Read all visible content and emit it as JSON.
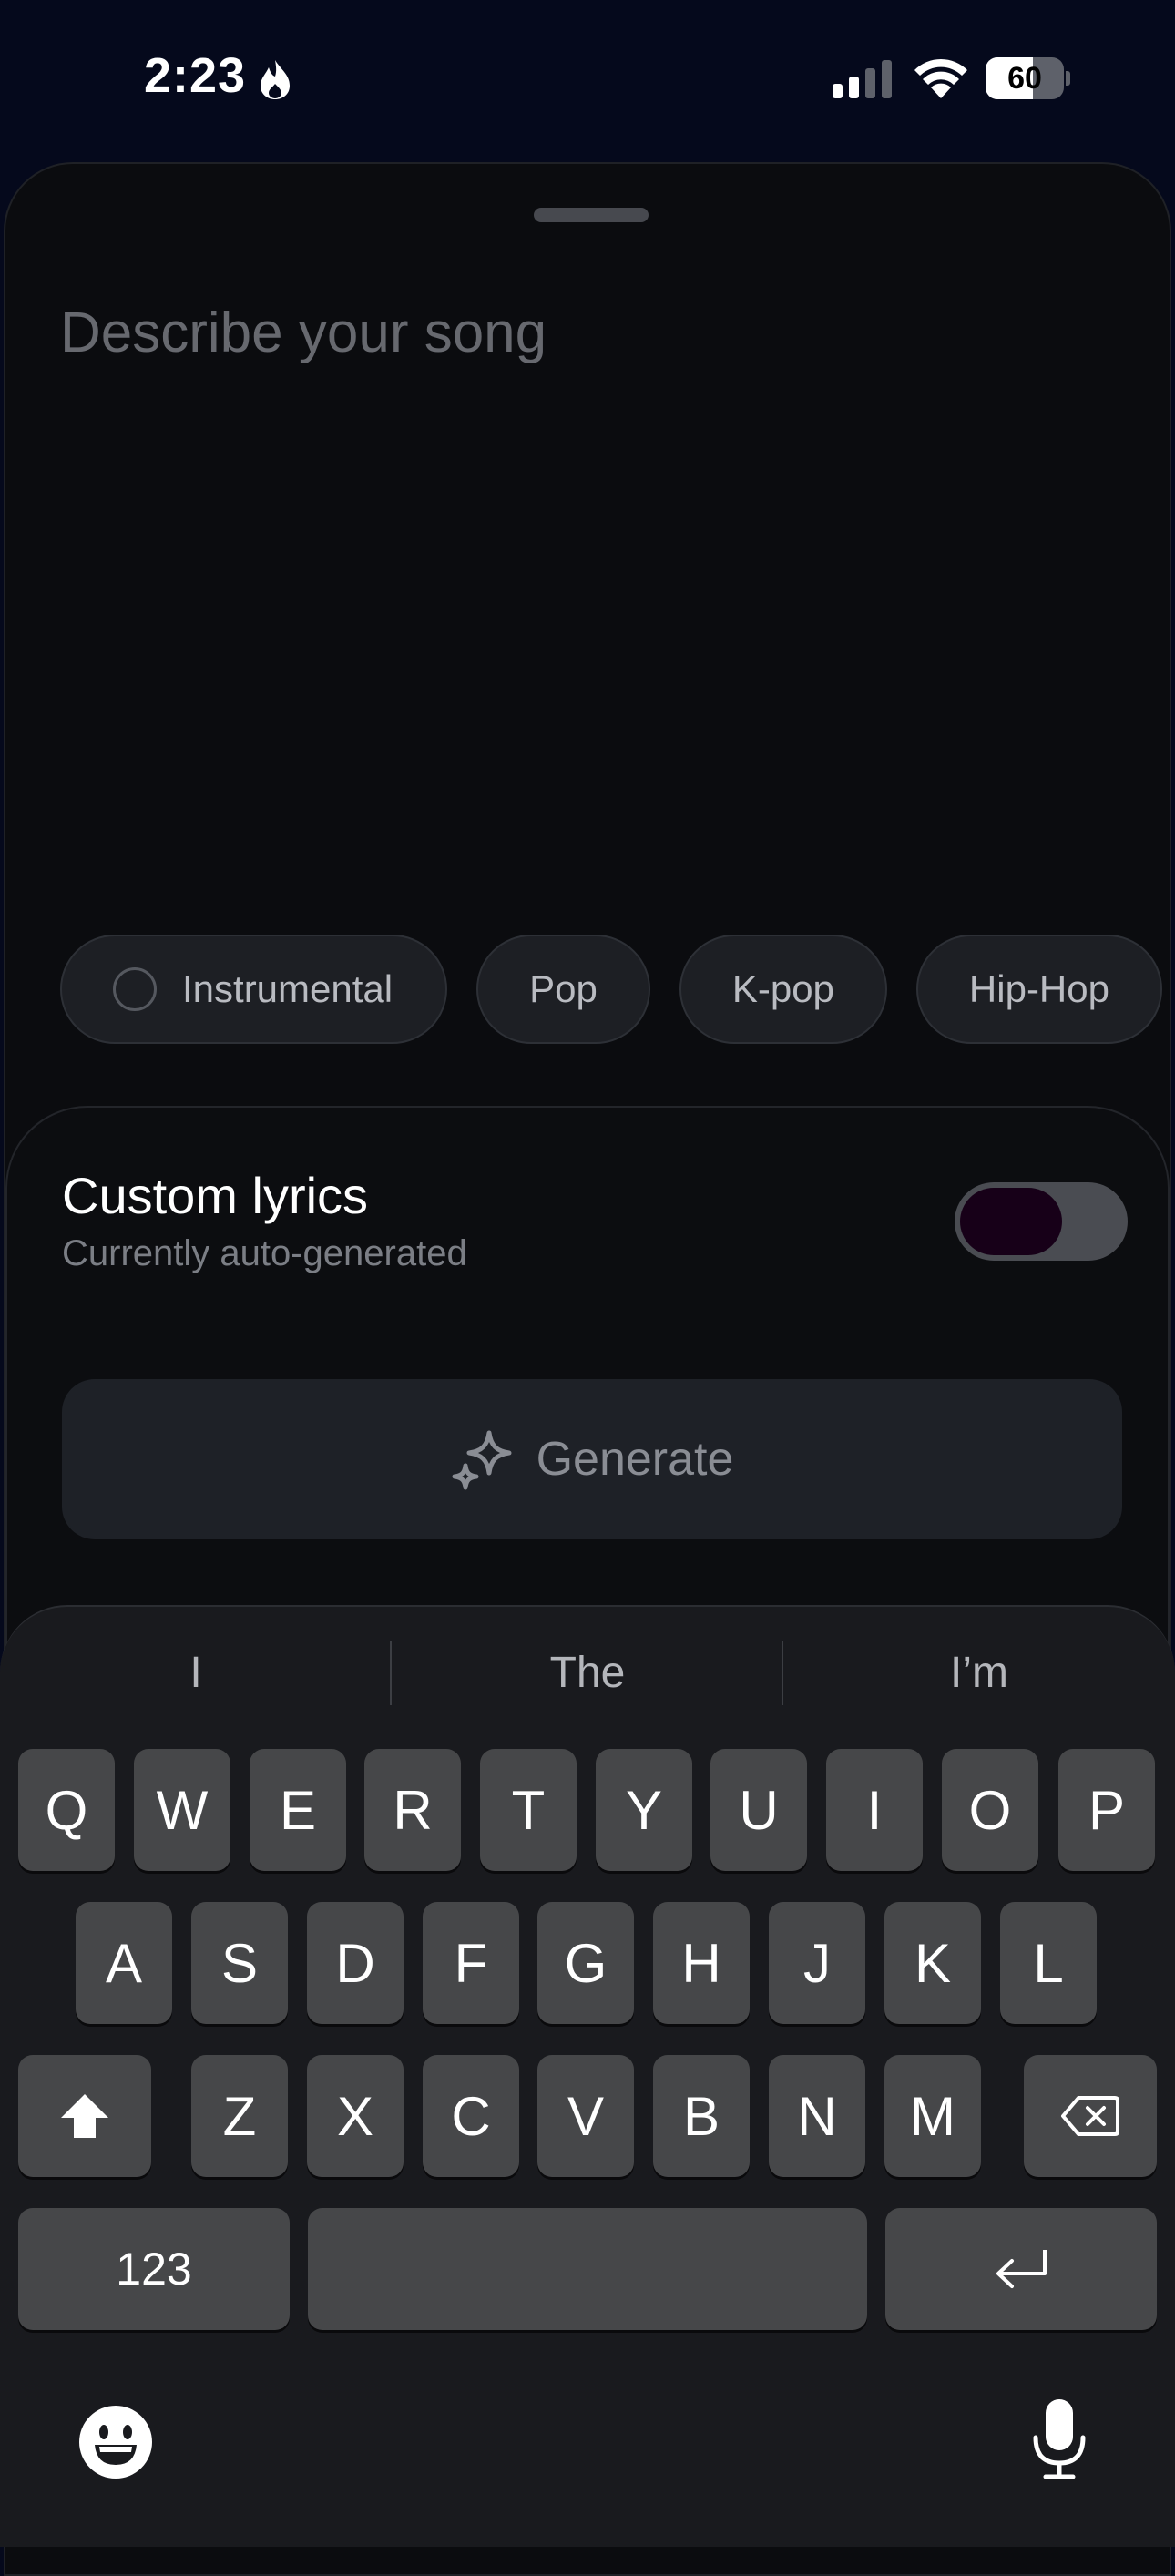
{
  "status_bar": {
    "time": "2:23",
    "battery_level": "60"
  },
  "prompt": {
    "placeholder": "Describe your song",
    "value": ""
  },
  "chips": [
    {
      "label": "Instrumental",
      "has_radio": true
    },
    {
      "label": "Pop"
    },
    {
      "label": "K-pop"
    },
    {
      "label": "Hip-Hop"
    }
  ],
  "lyrics": {
    "title": "Custom lyrics",
    "subtitle": "Currently auto-generated",
    "toggle_on": false
  },
  "generate": {
    "label": "Generate"
  },
  "keyboard": {
    "suggestions": [
      "I",
      "The",
      "I’m"
    ],
    "row1": [
      "Q",
      "W",
      "E",
      "R",
      "T",
      "Y",
      "U",
      "I",
      "O",
      "P"
    ],
    "row2": [
      "A",
      "S",
      "D",
      "F",
      "G",
      "H",
      "J",
      "K",
      "L"
    ],
    "row3": [
      "Z",
      "X",
      "C",
      "V",
      "B",
      "N",
      "M"
    ],
    "numbers_label": "123",
    "icons": {
      "shift": "shift-icon",
      "delete": "delete-icon",
      "return": "return-icon",
      "emoji": "emoji-icon",
      "mic": "microphone-icon"
    }
  },
  "colors": {
    "background": "#05091c",
    "sheet": "#0b0c0f",
    "chip": "#1d1f24",
    "toggle_knob": "#170018"
  }
}
